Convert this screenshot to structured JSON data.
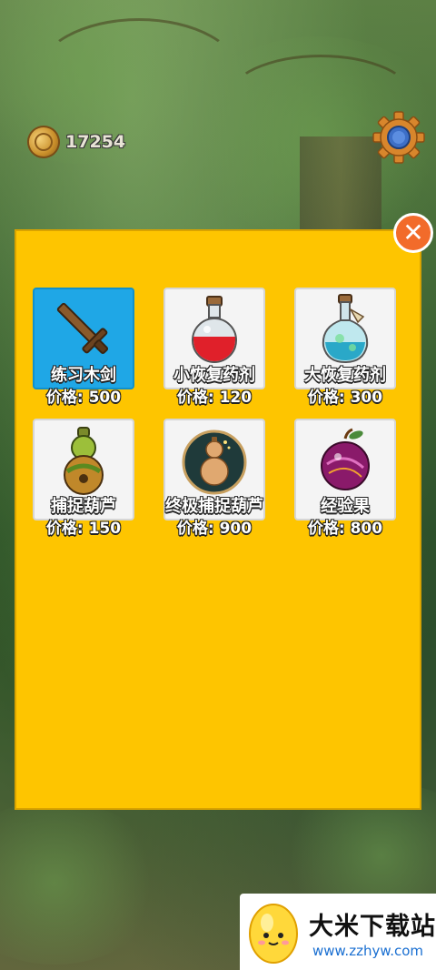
{
  "hud": {
    "coins": "17254",
    "coin_icon": "gold-coin-icon",
    "settings_icon": "gear-icon"
  },
  "shop": {
    "close_label": "✕",
    "items": [
      {
        "name": "练习木剑",
        "price": "价格: 500",
        "icon": "wooden-sword-icon",
        "selected": true
      },
      {
        "name": "小恢复药剂",
        "price": "价格: 120",
        "icon": "red-potion-icon",
        "selected": false
      },
      {
        "name": "大恢复药剂",
        "price": "价格: 300",
        "icon": "blue-potion-icon",
        "selected": false
      },
      {
        "name": "捕捉葫芦",
        "price": "价格: 150",
        "icon": "gourd-icon",
        "selected": false
      },
      {
        "name": "终极捕捉葫芦",
        "price": "价格: 900",
        "icon": "ultimate-gourd-icon",
        "selected": false
      },
      {
        "name": "经验果",
        "price": "价格: 800",
        "icon": "exp-fruit-icon",
        "selected": false
      }
    ]
  },
  "watermark": {
    "title": "大米下载站",
    "url": "www.zzhyw.com"
  },
  "colors": {
    "panel": "#fec500",
    "selected": "#1fa7e6",
    "close": "#f26b2a"
  }
}
